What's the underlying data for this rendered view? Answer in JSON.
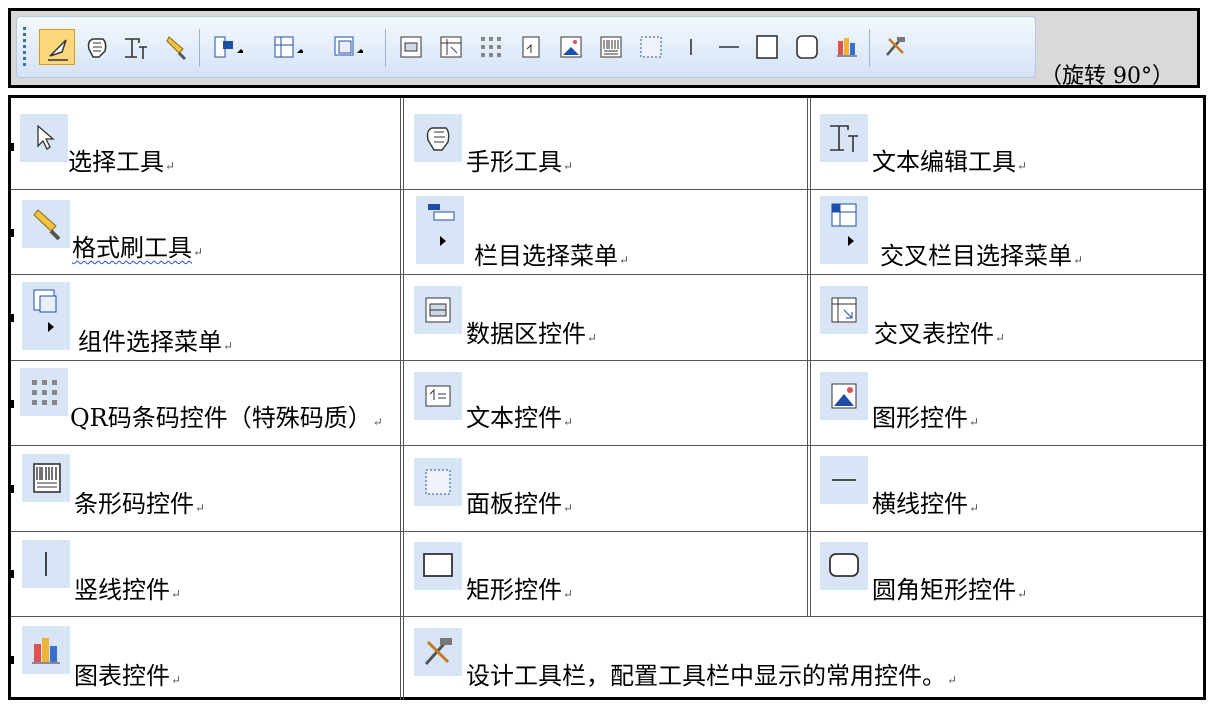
{
  "toolbar": {
    "rotation_note": "（旋转 90°）",
    "icons": [
      "select-tool-icon",
      "hand-tool-icon",
      "text-edit-tool-icon",
      "format-brush-icon",
      "column-select-menu-icon",
      "cross-column-select-menu-icon",
      "component-select-menu-icon",
      "data-area-control-icon",
      "crosstab-control-icon",
      "qr-barcode-control-icon",
      "text-control-icon",
      "image-control-icon",
      "barcode-control-icon",
      "panel-control-icon",
      "vertical-line-control-icon",
      "horizontal-line-control-icon",
      "rectangle-control-icon",
      "rounded-rectangle-control-icon",
      "chart-control-icon",
      "design-toolbar-icon"
    ]
  },
  "table": {
    "rows": [
      [
        {
          "label": "选择工具"
        },
        {
          "label": "手形工具"
        },
        {
          "label": "文本编辑工具"
        }
      ],
      [
        {
          "label": "格式刷工具"
        },
        {
          "label": "栏目选择菜单"
        },
        {
          "label": "交叉栏目选择菜单"
        }
      ],
      [
        {
          "label": "组件选择菜单"
        },
        {
          "label": "数据区控件"
        },
        {
          "label": "交叉表控件"
        }
      ],
      [
        {
          "label": "QR码条码控件（特殊码质）"
        },
        {
          "label": "文本控件"
        },
        {
          "label": "图形控件"
        }
      ],
      [
        {
          "label": "条形码控件"
        },
        {
          "label": "面板控件"
        },
        {
          "label": "横线控件"
        }
      ],
      [
        {
          "label": "竖线控件"
        },
        {
          "label": "矩形控件"
        },
        {
          "label": "圆角矩形控件"
        }
      ],
      [
        {
          "label": "图表控件"
        },
        {
          "label": "设计工具栏，配置工具栏中显示的常用控件。"
        }
      ]
    ]
  }
}
